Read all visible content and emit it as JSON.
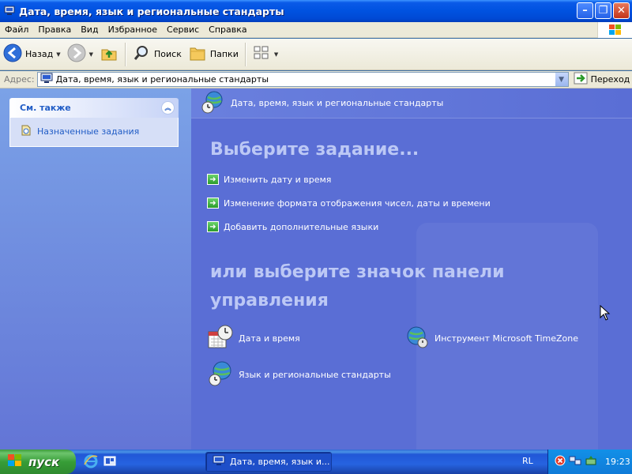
{
  "window": {
    "title": "Дата, время, язык и региональные стандарты",
    "minimize_glyph": "–",
    "maximize_glyph": "❐",
    "close_glyph": "✕"
  },
  "menu": {
    "items": [
      "Файл",
      "Правка",
      "Вид",
      "Избранное",
      "Сервис",
      "Справка"
    ]
  },
  "toolbar": {
    "back_label": "Назад",
    "search_label": "Поиск",
    "folders_label": "Папки"
  },
  "address": {
    "label": "Адрес:",
    "value": "Дата, время, язык и региональные стандарты",
    "go_label": "Переход"
  },
  "see_also": {
    "title": "См. также",
    "items": [
      "Назначенные задания"
    ]
  },
  "content": {
    "header": "Дата, время, язык и региональные стандарты",
    "pick_task": "Выберите задание...",
    "tasks": [
      "Изменить дату и время",
      "Изменение формата отображения чисел, даты и времени",
      "Добавить дополнительные языки"
    ],
    "pick_icon_line1": "или выберите значок панели",
    "pick_icon_line2": "управления",
    "icons": [
      "Дата и время",
      "Инструмент Microsoft TimeZone",
      "Язык и региональные стандарты"
    ]
  },
  "taskbar": {
    "start_label": "пуск",
    "task_label": "Дата, время, язык и...",
    "language": "RL",
    "clock": "19:23"
  },
  "colors": {
    "title_bar": "#0052e0",
    "content_bg": "#5a6ed5",
    "link": "#215dc6",
    "start_green": "#379d37"
  }
}
